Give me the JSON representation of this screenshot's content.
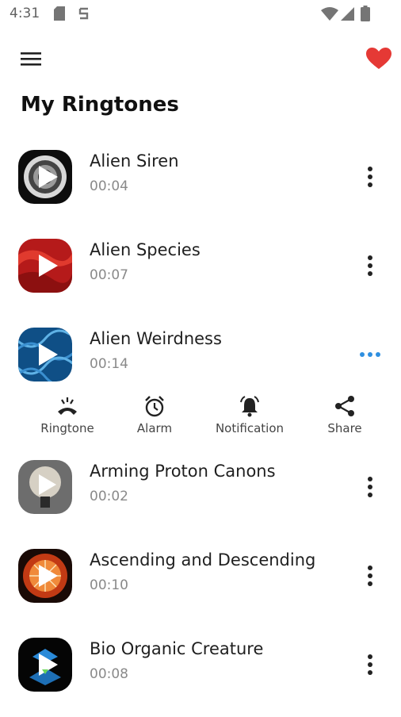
{
  "status_bar": {
    "time": "4:31"
  },
  "header": {
    "title": "My Ringtones"
  },
  "colors": {
    "accent": "#2f8fe0",
    "heart": "#e53935",
    "text": "#1f1f1f",
    "muted": "#8a8a8a"
  },
  "ringtones": [
    {
      "title": "Alien Siren",
      "duration": "00:04"
    },
    {
      "title": "Alien Species",
      "duration": "00:07"
    },
    {
      "title": "Alien Weirdness",
      "duration": "00:14"
    },
    {
      "title": "Arming Proton Canons",
      "duration": "00:02"
    },
    {
      "title": "Ascending and Descending",
      "duration": "00:10"
    },
    {
      "title": "Bio Organic Creature",
      "duration": "00:08"
    }
  ],
  "actions": {
    "ringtone": "Ringtone",
    "alarm": "Alarm",
    "notification": "Notification",
    "share": "Share"
  }
}
